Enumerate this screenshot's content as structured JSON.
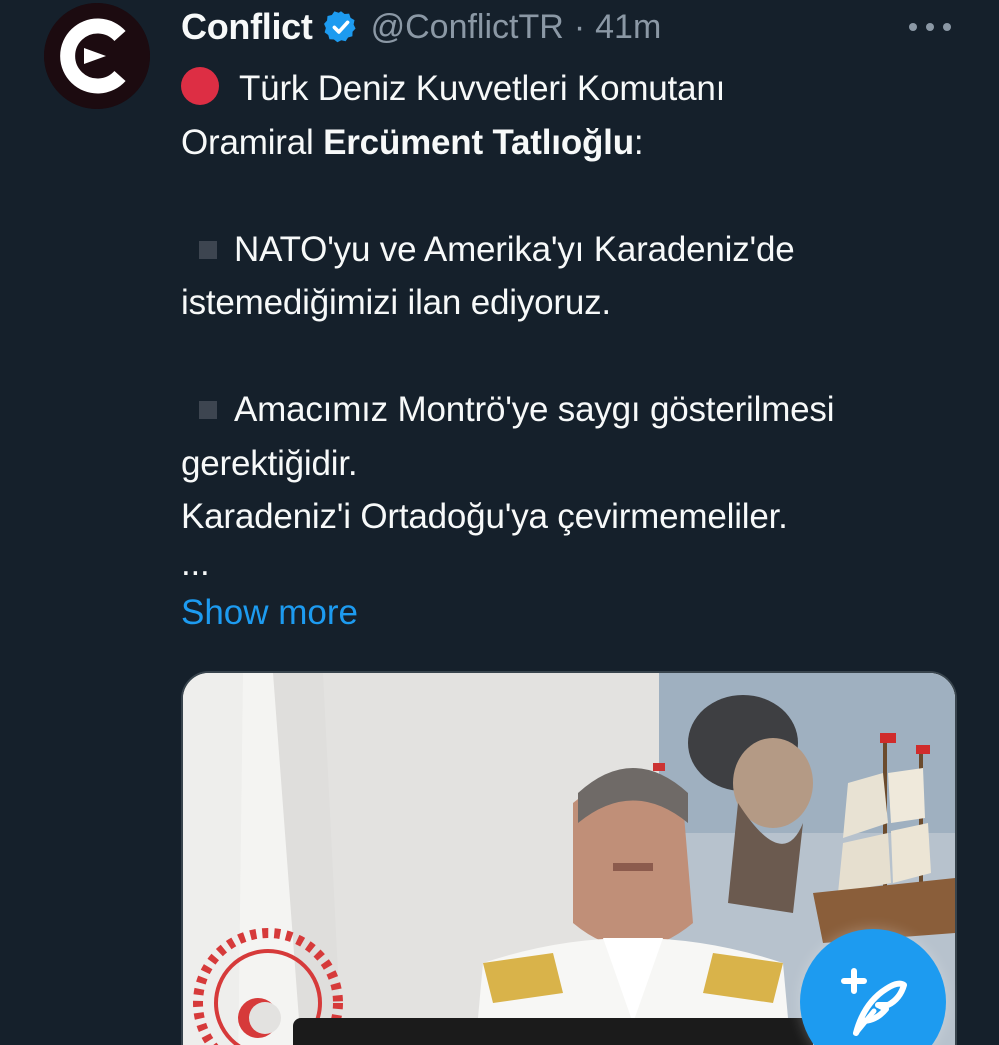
{
  "author": {
    "display_name": "Conflict",
    "handle": "@ConflictTR",
    "separator": "·",
    "time": "41m",
    "verified_icon": "verified-badge-icon",
    "avatar_icon": "conflict-logo-icon"
  },
  "tweet": {
    "line1": "Türk Deniz Kuvvetleri Komutanı",
    "line2_normal": "Oramiral ",
    "line2_bold": "Ercüment Tatlıoğlu",
    "line2_end": ":",
    "line3": "NATO'yu ve Amerika'yı Karadeniz'de",
    "line4": "istemediğimizi ilan ediyoruz.",
    "line5": "Amacımız Montrö'ye saygı gösterilmesi",
    "line6": "gerektiğidir.",
    "line7": "Karadeniz'i Ortadoğu'ya çevirmemeliler.",
    "line8": "...",
    "show_more": "Show more"
  },
  "colors": {
    "background": "#15202b",
    "text": "#f7f9f9",
    "muted": "#8b98a5",
    "accent": "#1d9bf0",
    "red": "#dd2e44"
  },
  "compose_button": {
    "icon": "compose-feather-plus-icon"
  }
}
